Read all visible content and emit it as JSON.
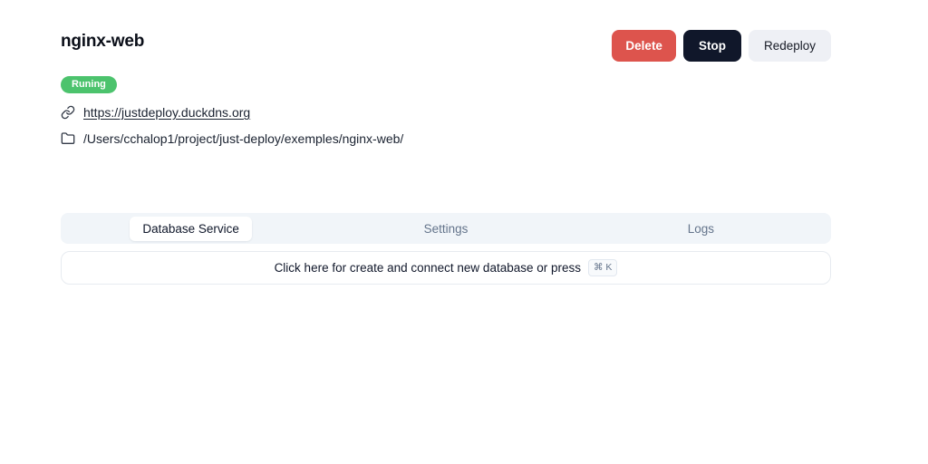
{
  "header": {
    "title": "nginx-web",
    "status_label": "Runing",
    "url": "https://justdeploy.duckdns.org",
    "path": "/Users/cchalop1/project/just-deploy/exemples/nginx-web/",
    "buttons": {
      "delete": "Delete",
      "stop": "Stop",
      "redeploy": "Redeploy"
    }
  },
  "tabs": [
    {
      "label": "Database Service",
      "active": true
    },
    {
      "label": "Settings",
      "active": false
    },
    {
      "label": "Logs",
      "active": false
    }
  ],
  "database_bar": {
    "text": "Click here for create and connect new database or press",
    "kbd": "⌘ K"
  },
  "icons": {
    "url_row": "link-icon",
    "path_row": "folder-icon"
  },
  "colors": {
    "delete_button": "#dd544d",
    "stop_button": "#10172a",
    "redeploy_button": "#eef0f5",
    "status_badge": "#4cc36d",
    "tabs_background": "#f1f5f9",
    "muted_text": "#64748b",
    "page_background": "#ffffff"
  }
}
